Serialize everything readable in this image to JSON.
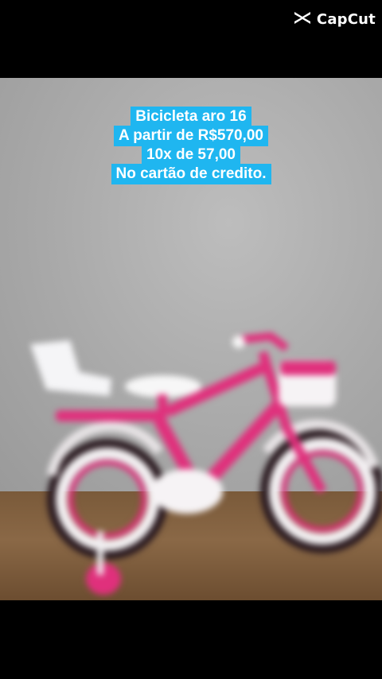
{
  "watermark": {
    "icon": "capcut-logo-icon",
    "text": "CapCut"
  },
  "caption": {
    "lines": [
      "Bicicleta aro 16",
      "A partir de R$570,00",
      "10x de 57,00",
      "No cartão de credito."
    ],
    "background_color": "#1fb6f0",
    "text_color": "#ffffff"
  }
}
